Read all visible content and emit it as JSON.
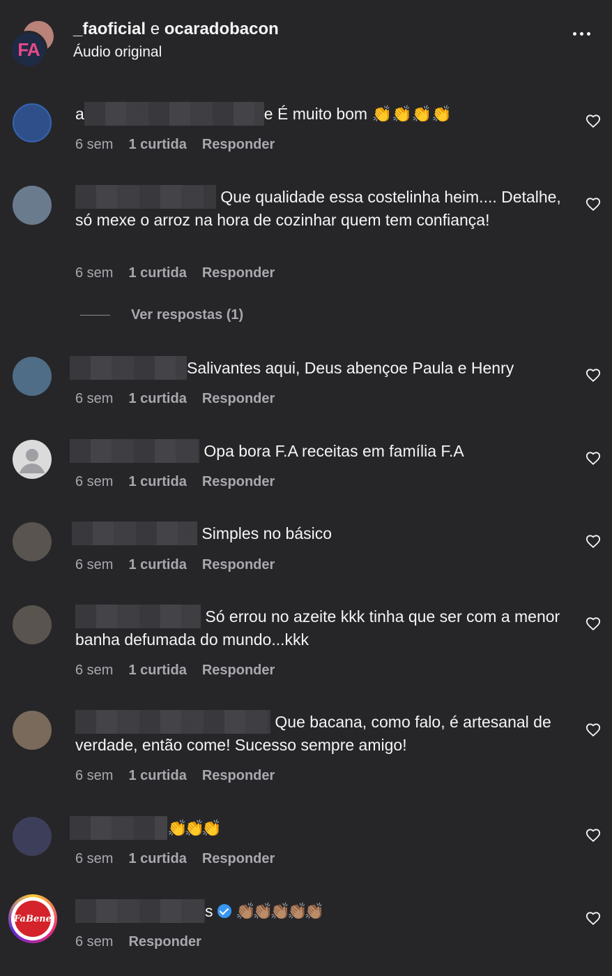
{
  "header": {
    "user1": "_faoficial",
    "conj": "e",
    "user2": "ocaradobacon",
    "subtitle": "Áudio original",
    "avatar_text": "FA"
  },
  "comments": [
    {
      "prefix": "a",
      "suffix": "e",
      "text": " É muito bom 👏👏👏👏",
      "time": "6 sem",
      "likes": "1 curtida",
      "reply": "Responder"
    },
    {
      "prefix": "",
      "suffix": "",
      "text": "Que qualidade essa costelinha heim.... Detalhe, só mexe o arroz na hora de cozinhar quem tem confiança!",
      "time": "6 sem",
      "likes": "1 curtida",
      "reply": "Responder"
    },
    {
      "prefix": "",
      "suffix": "",
      "text": "Salivantes aqui, Deus abençoe Paula e Henry",
      "time": "6 sem",
      "likes": "1 curtida",
      "reply": "Responder"
    },
    {
      "prefix": "",
      "suffix": "",
      "text": " Opa bora F.A receitas em família F.A",
      "time": "6 sem",
      "likes": "1 curtida",
      "reply": "Responder"
    },
    {
      "prefix": "",
      "suffix": "",
      "text": " Simples no básico",
      "time": "6 sem",
      "likes": "1 curtida",
      "reply": "Responder"
    },
    {
      "prefix": "",
      "suffix": "",
      "text": " Só errou no azeite kkk tinha que ser com a menor banha defumada do mundo...kkk",
      "time": "6 sem",
      "likes": "1 curtida",
      "reply": "Responder"
    },
    {
      "prefix": "",
      "suffix": "",
      "text": " Que bacana, como falo, é artesanal de verdade, então come! Sucesso sempre amigo!",
      "time": "6 sem",
      "likes": "1 curtida",
      "reply": "Responder"
    },
    {
      "prefix": "",
      "suffix": "",
      "text": "👏👏👏",
      "time": "6 sem",
      "likes": "1 curtida",
      "reply": "Responder"
    },
    {
      "prefix": "",
      "suffix": "s",
      "text": "👏🏽👏🏽👏🏽👏🏽👏🏽",
      "time": "6 sem",
      "likes": "",
      "reply": "Responder"
    }
  ],
  "view_replies": "Ver respostas (1)",
  "last_avatar_text": "FaBene"
}
